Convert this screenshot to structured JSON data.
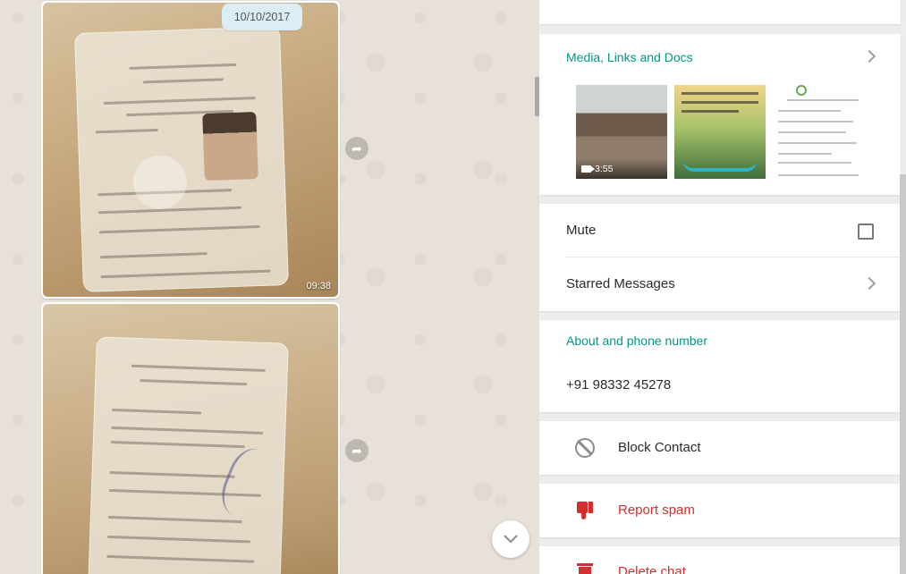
{
  "chat": {
    "date_label": "10/10/2017",
    "messages": [
      {
        "type": "image",
        "time": "09:38"
      },
      {
        "type": "image",
        "time": ""
      }
    ]
  },
  "info_panel": {
    "media": {
      "title": "Media, Links and Docs",
      "video_duration": "3:55"
    },
    "mute_label": "Mute",
    "mute_checked": false,
    "starred_label": "Starred Messages",
    "about_title": "About and phone number",
    "phone": "+91 98332 45278",
    "block_label": "Block Contact",
    "report_label": "Report spam",
    "delete_label": "Delete chat"
  },
  "colors": {
    "accent": "#009688",
    "danger": "#d32f2f",
    "chat_bg": "#e5ddd5"
  }
}
